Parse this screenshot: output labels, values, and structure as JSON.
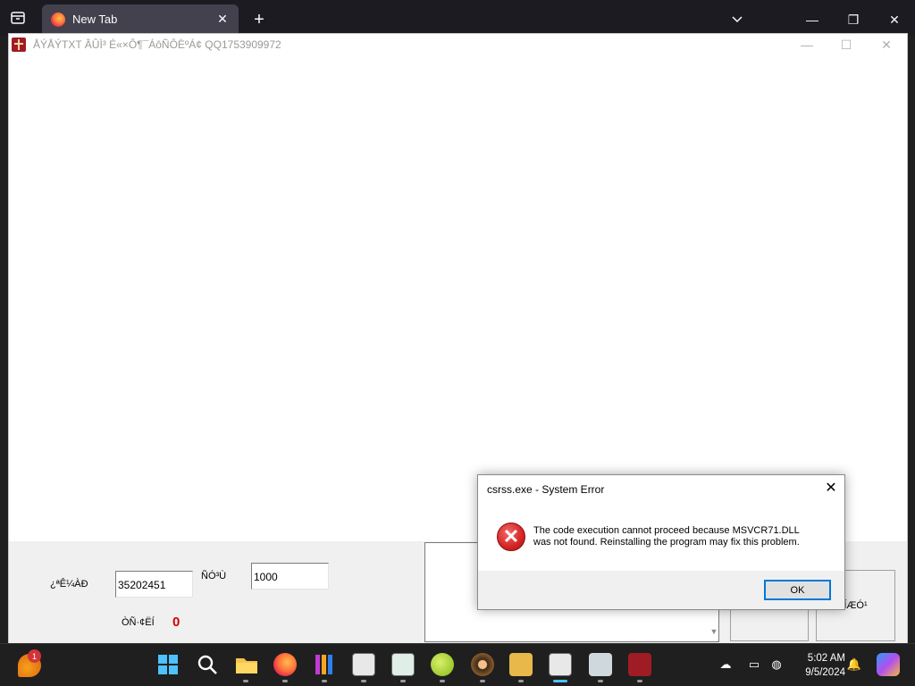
{
  "browser": {
    "tab_title": "New Tab",
    "tab_close_glyph": "✕",
    "new_tab_glyph": "+",
    "window_controls": [
      "—",
      "❐",
      "✕"
    ]
  },
  "app": {
    "title": "ÅÝÅÝTXT ÂÛÌ³ É«×Ô¶¯ÁôÑÔÈºÁ¢ QQ1753909972",
    "controls": [
      "—",
      "☐",
      "✕"
    ],
    "label_account": "¿ªÊ¼ÀÐ",
    "account_value": "35202451",
    "label_delay": "ÑÓ³Ù",
    "delay_value": "1000",
    "label_sent": "ÒÑ·¢ËÍ",
    "sent_count": "0",
    "button_start_text": "",
    "button_stop_text": "ÍÆÓ¹"
  },
  "dialog": {
    "title": "csrss.exe - System Error",
    "message_line1": "The code execution cannot proceed because MSVCR71.DLL",
    "message_line2": "was not found. Reinstalling the program may fix this problem.",
    "ok_label": "OK",
    "close_glyph": "✕"
  },
  "taskbar": {
    "widget_badge": "1",
    "clock_time": "5:02 AM",
    "clock_date": "9/5/2024"
  },
  "colors": {
    "error_red": "#d42424",
    "count_red": "#d00000",
    "focus_blue": "#0078d7"
  }
}
